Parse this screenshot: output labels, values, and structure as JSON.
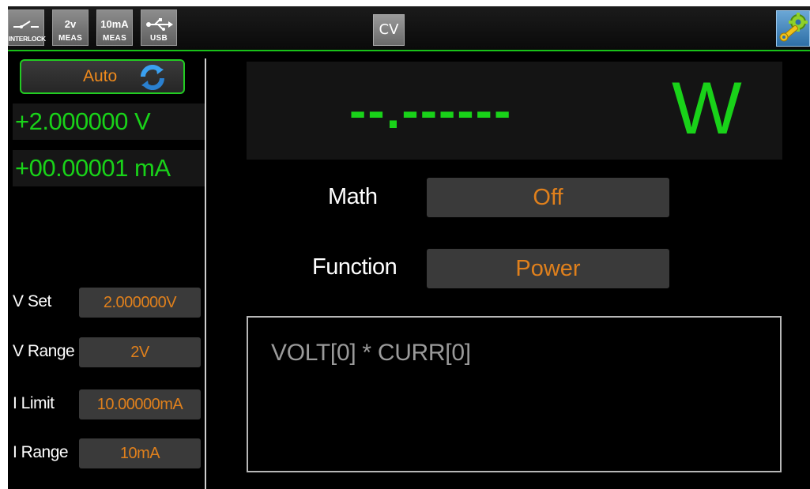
{
  "status_bar": {
    "interlock": {
      "icon": "switch-icon",
      "label": "INTERLOCK"
    },
    "volt_meas": {
      "range": "2v",
      "label": "MEAS"
    },
    "curr_meas": {
      "range": "10mA",
      "label": "MEAS"
    },
    "usb": {
      "icon": "usb-icon",
      "label": "USB"
    },
    "mode": "CV",
    "settings_icon": "wrench-gear-icon"
  },
  "left_panel": {
    "range_mode": {
      "label": "Auto",
      "icon": "refresh-icon"
    },
    "voltage_readout": "+2.000000 V",
    "current_readout": "+00.00001 mA",
    "params": [
      {
        "name": "V Set",
        "value": "2.000000V"
      },
      {
        "name": "V Range",
        "value": "2V"
      },
      {
        "name": "I Limit",
        "value": "10.00000mA"
      },
      {
        "name": "I Range",
        "value": "10mA"
      }
    ]
  },
  "right_panel": {
    "main_reading": "--.------",
    "main_unit": "W",
    "math": {
      "label": "Math",
      "value": "Off"
    },
    "function": {
      "label": "Function",
      "value": "Power"
    },
    "expression": "VOLT[0] * CURR[0]"
  },
  "colors": {
    "readout_green": "#19d219",
    "value_orange": "#e0801c",
    "accent_green": "#22cc22"
  }
}
